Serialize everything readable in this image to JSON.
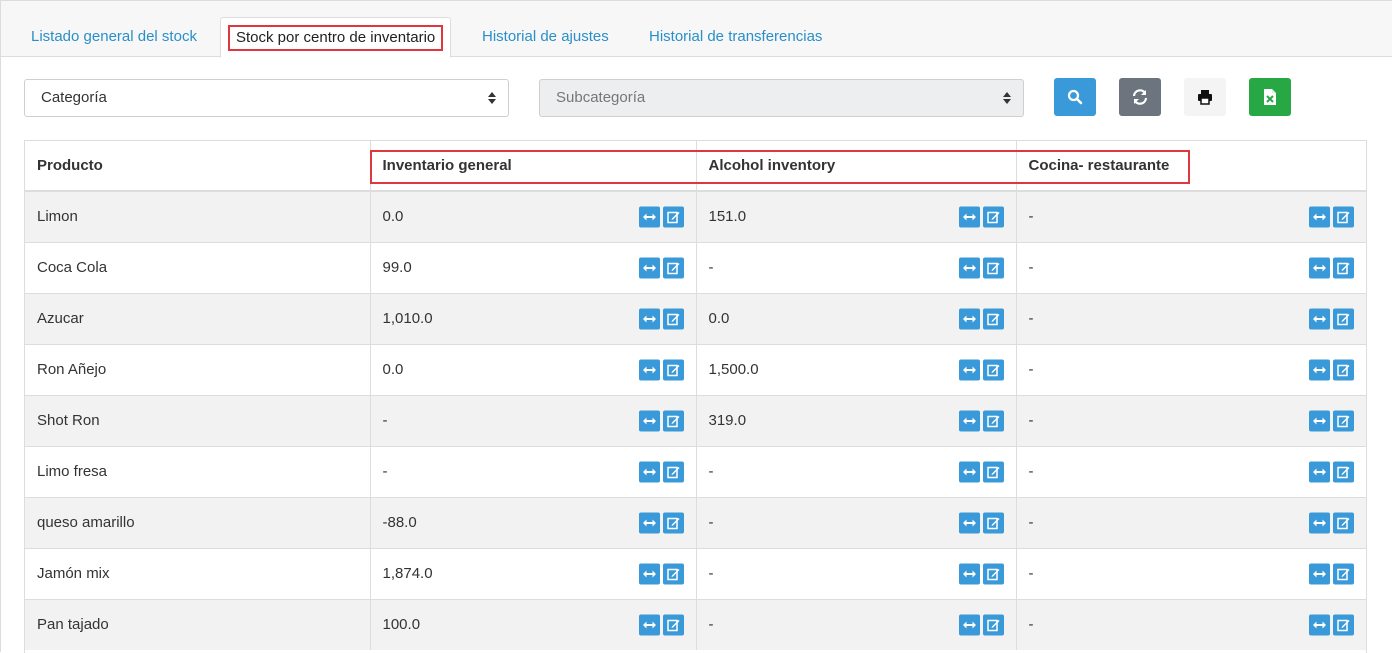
{
  "tabs": [
    {
      "label": "Listado general del stock",
      "active": false
    },
    {
      "label": "Stock por centro de inventario",
      "active": true
    },
    {
      "label": "Historial de ajustes",
      "active": false
    },
    {
      "label": "Historial de transferencias",
      "active": false
    }
  ],
  "filters": {
    "category": "Categoría",
    "subcategory": "Subcategoría"
  },
  "table": {
    "headers": [
      "Producto",
      "Inventario general",
      "Alcohol inventory",
      "Cocina- restaurante"
    ],
    "rows": [
      {
        "product": "Limon",
        "values": [
          "0.0",
          "151.0",
          "-"
        ]
      },
      {
        "product": "Coca Cola",
        "values": [
          "99.0",
          "-",
          "-"
        ]
      },
      {
        "product": "Azucar",
        "values": [
          "1,010.0",
          "0.0",
          "-"
        ]
      },
      {
        "product": "Ron Añejo",
        "values": [
          "0.0",
          "1,500.0",
          "-"
        ]
      },
      {
        "product": "Shot Ron",
        "values": [
          "-",
          "319.0",
          "-"
        ]
      },
      {
        "product": "Limo fresa",
        "values": [
          "-",
          "-",
          "-"
        ]
      },
      {
        "product": "queso amarillo",
        "values": [
          "-88.0",
          "-",
          "-"
        ]
      },
      {
        "product": "Jamón mix",
        "values": [
          "1,874.0",
          "-",
          "-"
        ]
      },
      {
        "product": "Pan tajado",
        "values": [
          "100.0",
          "-",
          "-"
        ]
      }
    ]
  },
  "colors": {
    "accent": "#3a9ad9",
    "highlight": "#e0373e",
    "excel": "#28a745",
    "refresh": "#6c757d"
  },
  "icons": {
    "search": "search-icon",
    "refresh": "refresh-icon",
    "print": "print-icon",
    "excel": "excel-icon",
    "transfer": "transfer-icon",
    "edit": "edit-icon"
  }
}
